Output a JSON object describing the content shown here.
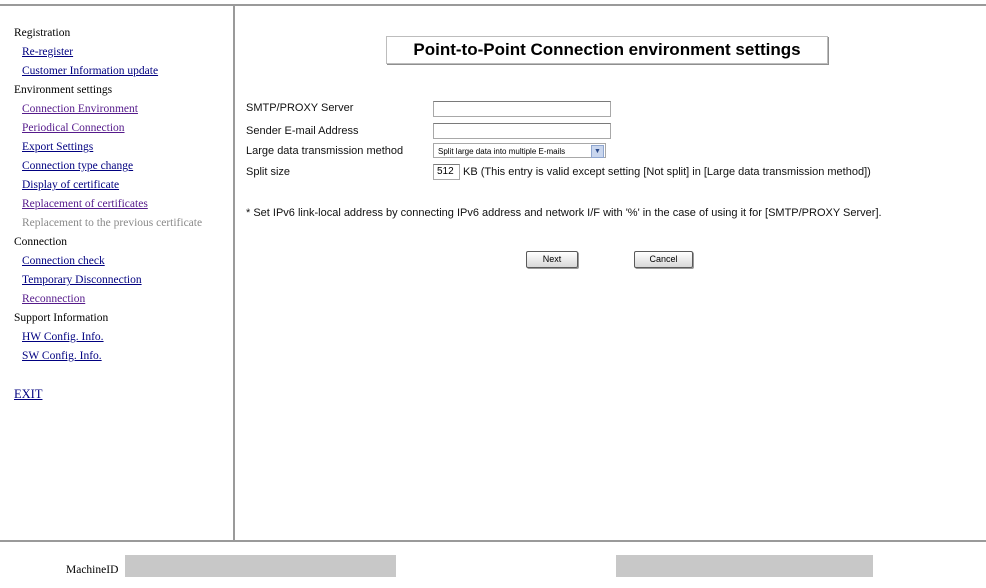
{
  "sidebar": {
    "groups": [
      {
        "heading": "Registration",
        "items": [
          {
            "label": "Re-register"
          },
          {
            "label": "Customer Information update"
          }
        ]
      },
      {
        "heading": "Environment settings",
        "items": [
          {
            "label": "Connection Environment"
          },
          {
            "label": "Periodical Connection"
          },
          {
            "label": "Export Settings"
          },
          {
            "label": "Connection type change"
          },
          {
            "label": "Display of certificate"
          },
          {
            "label": "Replacement of certificates"
          },
          {
            "label": "Replacement to the previous certificate"
          }
        ]
      },
      {
        "heading": "Connection",
        "items": [
          {
            "label": "Connection check"
          },
          {
            "label": "Temporary Disconnection"
          },
          {
            "label": "Reconnection"
          }
        ]
      },
      {
        "heading": "Support Information",
        "items": [
          {
            "label": "HW Config. Info."
          },
          {
            "label": "SW Config. Info."
          }
        ]
      }
    ],
    "exit_label": "EXIT"
  },
  "main": {
    "title": "Point-to-Point Connection environment settings",
    "fields": {
      "smtp_label": "SMTP/PROXY Server",
      "smtp_value": "",
      "sender_label": "Sender E-mail Address",
      "sender_value": "",
      "large_data_label": "Large data transmission method",
      "large_data_value": "Split large data into multiple E-mails",
      "split_label": "Split size",
      "split_value": "512",
      "split_hint": "KB (This entry is valid except setting [Not split] in [Large data transmission method])"
    },
    "note": "* Set IPv6 link-local address by connecting IPv6 address and network I/F with '%' in the case of using it for [SMTP/PROXY Server].",
    "buttons": {
      "next": "Next",
      "cancel": "Cancel"
    }
  },
  "footer": {
    "machine_id_label": "MachineID",
    "machine_id_value": "",
    "right_value": ""
  }
}
